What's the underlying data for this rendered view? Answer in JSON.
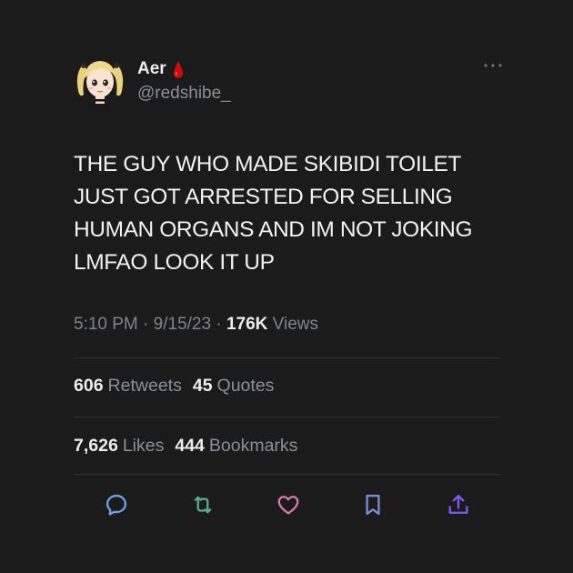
{
  "author": {
    "display_name": "Aer",
    "handle": "@redshibe_"
  },
  "tweet": {
    "text": "THE GUY WHO MADE SKIBIDI TOILET JUST GOT ARRESTED FOR SELLING HUMAN ORGANS AND IM NOT JOKING LMFAO LOOK IT UP",
    "time": "5:10 PM",
    "sep1": "·",
    "date": "9/15/23",
    "sep2": "·",
    "views_count": "176K",
    "views_label": "Views"
  },
  "stats": {
    "retweets_count": "606",
    "retweets_label": "Retweets",
    "quotes_count": "45",
    "quotes_label": "Quotes",
    "likes_count": "7,626",
    "likes_label": "Likes",
    "bookmarks_count": "444",
    "bookmarks_label": "Bookmarks"
  },
  "icons": {
    "more": "more-horizontal-icon",
    "reply": "reply-icon",
    "retweet": "retweet-icon",
    "like": "heart-icon",
    "bookmark": "bookmark-icon",
    "share": "share-icon",
    "badge": "blood-drop-icon"
  },
  "colors": {
    "background": "#1b1b1b",
    "accent": "#7a5cf0",
    "badge_red": "#d10a0a",
    "muted": "#8b8f94"
  }
}
